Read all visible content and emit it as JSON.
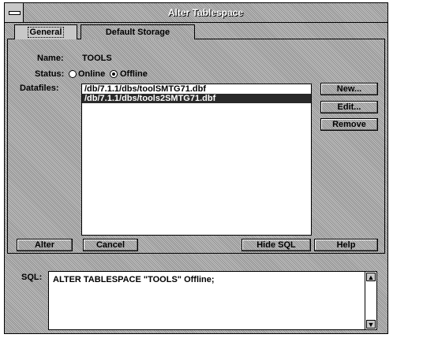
{
  "window": {
    "title": "Alter Tablespace"
  },
  "tabs": [
    {
      "label": "General"
    },
    {
      "label": "Default Storage"
    }
  ],
  "general": {
    "name_label": "Name:",
    "name_value": "TOOLS",
    "status_label": "Status:",
    "status_options": [
      "Online",
      "Offline"
    ],
    "status_selected": "Offline",
    "datafiles_label": "Datafiles:",
    "datafiles": [
      "/db/7.1.1/dbs/toolSMTG71.dbf",
      "/db/7.1.1/dbs/tools2SMTG71.dbf"
    ],
    "selected_datafile": "/db/7.1.1/dbs/tools2SMTG71.dbf",
    "new_label": "New...",
    "edit_label": "Edit...",
    "remove_label": "Remove"
  },
  "actions": {
    "alter_label": "Alter",
    "cancel_label": "Cancel",
    "hide_sql_label": "Hide SQL",
    "help_label": "Help"
  },
  "sql": {
    "label": "SQL:",
    "text": "ALTER TABLESPACE \"TOOLS\" Offline;"
  }
}
